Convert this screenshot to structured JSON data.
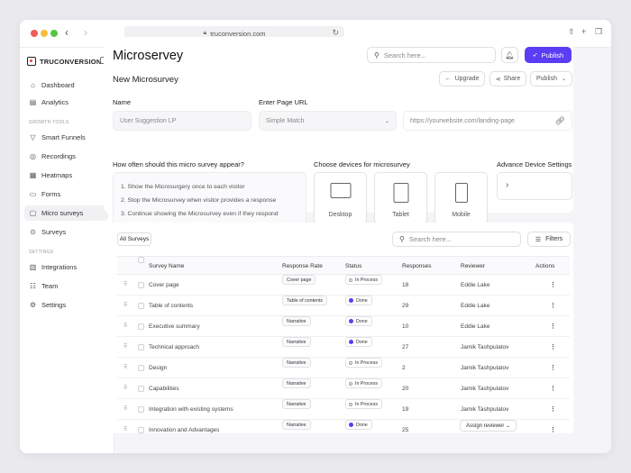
{
  "browser": {
    "url": "truconversion.com"
  },
  "brand": {
    "name": "TRUCONVERSION",
    "accent": "#5b3df5"
  },
  "sidebar": {
    "top_items": [
      {
        "label": "Dashboard",
        "icon": "home-icon"
      },
      {
        "label": "Analytics",
        "icon": "analytics-icon"
      }
    ],
    "growth_tools_title": "GROWTH TOOLS",
    "growth_items": [
      {
        "label": "Smart Funnels",
        "icon": "funnel-icon"
      },
      {
        "label": "Recordings",
        "icon": "recording-icon"
      },
      {
        "label": "Heatmaps",
        "icon": "heatmap-icon"
      },
      {
        "label": "Forms",
        "icon": "form-icon"
      },
      {
        "label": "Micro surveys",
        "icon": "micro-survey-icon"
      },
      {
        "label": "Surveys",
        "icon": "survey-icon"
      }
    ],
    "settings_title": "SETTINGS",
    "settings_items": [
      {
        "label": "Integrations",
        "icon": "integrations-icon"
      },
      {
        "label": "Team",
        "icon": "team-icon"
      },
      {
        "label": "Settings",
        "icon": "gear-icon"
      }
    ]
  },
  "header": {
    "title": "Microservey",
    "search_placeholder": "Search here...",
    "publish_label": "Publish"
  },
  "form": {
    "subtitle": "New Microsurvey",
    "upgrade_label": "Upgrade",
    "share_label": "Share",
    "publish_dropdown": "Publish",
    "name_label": "Name",
    "name_value": "User Suggestion LP",
    "page_url_label": "Enter Page URL",
    "match_value": "Simple Match",
    "url_value": "https://yourwebsite.com/landing-page",
    "frequency_label": "How often should this micro survey appear?",
    "frequency_options": [
      "1. Show the Microsurgery once to each visitor",
      "2. Stop the Microsurvey when visitor provides a response",
      "3. Continue showing the Microsurvey even if they respond"
    ],
    "devices_label": "Choose devices for microsurvey",
    "devices": [
      "Desktop",
      "Tablet",
      "Mobile"
    ],
    "advance_label": "Advance Device Settings"
  },
  "table": {
    "filter_label": "All Surveys",
    "search_placeholder": "Search here...",
    "filters_label": "Filters",
    "columns": [
      "Survey Name",
      "Response Rate",
      "Status",
      "Responses",
      "Reviewer",
      "Actions"
    ],
    "rows": [
      {
        "name": "Cover page",
        "rate": "Cover page",
        "status": "In Process",
        "responses": "18",
        "reviewer": "Eddie Lake"
      },
      {
        "name": "Table of contents",
        "rate": "Table of contents",
        "status": "Done",
        "responses": "29",
        "reviewer": "Eddie Lake"
      },
      {
        "name": "Executive summary",
        "rate": "Narrative",
        "status": "Done",
        "responses": "10",
        "reviewer": "Eddie Lake"
      },
      {
        "name": "Technical approach",
        "rate": "Narrative",
        "status": "Done",
        "responses": "27",
        "reviewer": "Jamik Tashpulatov"
      },
      {
        "name": "Design",
        "rate": "Narrative",
        "status": "In Process",
        "responses": "2",
        "reviewer": "Jamik Tashpulatov"
      },
      {
        "name": "Capabilities",
        "rate": "Narrative",
        "status": "In Process",
        "responses": "20",
        "reviewer": "Jamik Tashpulatov"
      },
      {
        "name": "Integration with existing systems",
        "rate": "Narrative",
        "status": "In Process",
        "responses": "19",
        "reviewer": "Jamik Tashpulatov"
      },
      {
        "name": "Innovation and Advantages",
        "rate": "Narrative",
        "status": "Done",
        "responses": "25",
        "reviewer": ""
      }
    ],
    "assign_label": "Assign reviewer"
  }
}
